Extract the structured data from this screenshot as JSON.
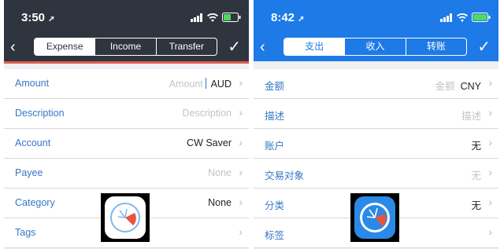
{
  "left": {
    "status": {
      "time": "3:50"
    },
    "nav": {
      "tabs": [
        "Expense",
        "Income",
        "Transfer"
      ]
    },
    "rows": [
      {
        "label": "Amount",
        "placeholder": "Amount",
        "value": "AUD"
      },
      {
        "label": "Description",
        "placeholder": "Description",
        "value": ""
      },
      {
        "label": "Account",
        "placeholder": "",
        "value": "CW Saver"
      },
      {
        "label": "Payee",
        "placeholder": "None",
        "value": ""
      },
      {
        "label": "Category",
        "placeholder": "",
        "value": "None"
      },
      {
        "label": "Tags",
        "placeholder": "",
        "value": ""
      }
    ]
  },
  "right": {
    "status": {
      "time": "8:42"
    },
    "nav": {
      "tabs": [
        "支出",
        "收入",
        "转账"
      ]
    },
    "rows": [
      {
        "label": "金额",
        "placeholder": "金额",
        "value": "CNY"
      },
      {
        "label": "描述",
        "placeholder": "描述",
        "value": ""
      },
      {
        "label": "账户",
        "placeholder": "",
        "value": "无"
      },
      {
        "label": "交易对象",
        "placeholder": "无",
        "value": ""
      },
      {
        "label": "分类",
        "placeholder": "",
        "value": "无"
      },
      {
        "label": "标签",
        "placeholder": "",
        "value": ""
      }
    ]
  },
  "colors": {
    "dark_nav": "#2f353e",
    "blue_nav": "#1d7ae6",
    "accent_red": "#e15c4e",
    "label_blue": "#3478c6"
  },
  "icons": [
    "location-arrow-icon",
    "signal-icon",
    "wifi-icon",
    "battery-icon",
    "back-chevron-icon",
    "checkmark-icon",
    "chevron-right-icon",
    "app-logo-icon"
  ]
}
